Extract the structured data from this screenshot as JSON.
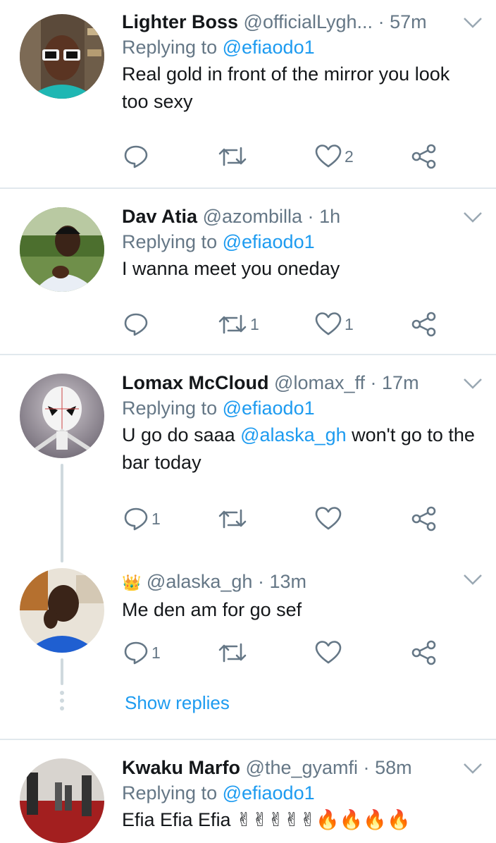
{
  "tweets": [
    {
      "name": "Lighter Boss",
      "handle": "@officialLygh...",
      "dot": "·",
      "time": "57m",
      "replying_prefix": "Replying to ",
      "replying_handle": "@efiaodo1",
      "text": "Real gold in front of the mirror you look too sexy",
      "replies": "",
      "retweets": "",
      "likes": "2"
    },
    {
      "name": "Dav Atia",
      "handle": "@azombilla",
      "dot": "·",
      "time": "1h",
      "replying_prefix": "Replying to ",
      "replying_handle": "@efiaodo1",
      "text": "I wanna meet you oneday",
      "replies": "",
      "retweets": "1",
      "likes": "1"
    },
    {
      "name": "Lomax McCloud",
      "handle": "@lomax_ff",
      "dot": "·",
      "time": "17m",
      "replying_prefix": "Replying to ",
      "replying_handle": "@efiaodo1",
      "text_before": "U go do saaa ",
      "text_mention": "@alaska_gh",
      "text_after": " won't go to the bar today",
      "replies": "1",
      "retweets": "",
      "likes": ""
    },
    {
      "name_emoji": "👑",
      "handle": "@alaska_gh",
      "dot": "·",
      "time": "13m",
      "text": "Me den am for go sef",
      "replies": "1",
      "retweets": "",
      "likes": ""
    },
    {
      "name": "Kwaku Marfo",
      "handle": "@the_gyamfi",
      "dot": "·",
      "time": "58m",
      "replying_prefix": "Replying to ",
      "replying_handle": "@efiaodo1",
      "text": "Efia Efia Efia ✌✌✌✌✌🔥🔥🔥🔥"
    }
  ],
  "show_replies_label": "Show replies",
  "icons": [
    "reply-icon",
    "retweet-icon",
    "like-icon",
    "share-icon",
    "chevron-down-icon"
  ],
  "colors": {
    "link": "#1d9bf0",
    "secondary": "#657786",
    "divider": "#e1e8ed"
  }
}
